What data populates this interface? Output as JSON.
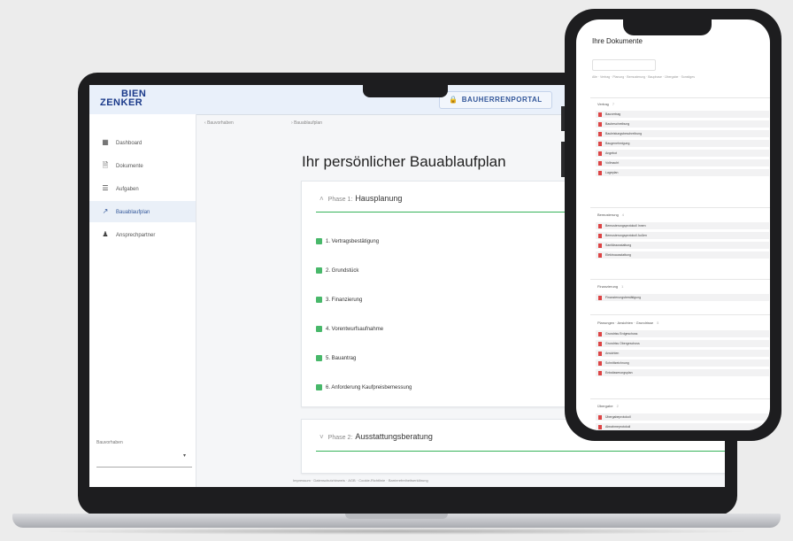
{
  "laptop": {
    "logo_line1": "BIEN",
    "logo_line2": "ZENKER",
    "portal_button": "BAUHERRENPORTAL",
    "sidebar": {
      "items": [
        {
          "label": "Dashboard",
          "icon": "dashboard-icon"
        },
        {
          "label": "Dokumente",
          "icon": "document-icon"
        },
        {
          "label": "Aufgaben",
          "icon": "tasks-icon"
        },
        {
          "label": "Bauablaufplan",
          "icon": "chart-line-icon"
        },
        {
          "label": "Ansprechpartner",
          "icon": "people-icon"
        }
      ],
      "active_index": 3,
      "select_label": "Bauvorhaben"
    },
    "breadcrumb": [
      "Bauvorhaben",
      "Bauablaufplan"
    ],
    "title": "Ihr persönlicher Bauablaufplan",
    "phases": [
      {
        "number": "Phase 1:",
        "name": "Hausplanung",
        "steps": [
          "1. Vertragsbestätigung",
          "2. Grundstück",
          "3. Finanzierung",
          "4. Vorentwurfsaufnahme",
          "5. Bauantrag",
          "6. Anforderung Kaufpreisbemessung"
        ]
      },
      {
        "number": "Phase 2:",
        "name": "Ausstattungsberatung",
        "steps": []
      }
    ],
    "footer_links": "Impressum · Datenschutzhinweis · AGB · Cookie-Richtlinie · Barrierefreiheitserklärung"
  },
  "phone": {
    "title": "Ihre Dokumente",
    "filter_text": "Alle · Vertrag · Planung · Bemusterung · Bauphase · Übergabe · Sonstiges",
    "sections": [
      {
        "name": "Vertrag",
        "count": "7",
        "items": [
          "Bauvertrag",
          "Baubeschreibung",
          "Bauleistungsbeschreibung",
          "Baugenehmigung",
          "Angebot",
          "Vollmacht",
          "Lageplan"
        ]
      },
      {
        "name": "Bemusterung",
        "count": "4",
        "items": [
          "Bemusterungsprotokoll Innen",
          "Bemusterungsprotokoll Außen",
          "Sanitärausstattung",
          "Elektroausstattung"
        ]
      },
      {
        "name": "Finanzierung",
        "count": "1",
        "items": [
          "Finanzierungsbestätigung"
        ]
      },
      {
        "name": "Planungen · Ansichten · Grundrisse",
        "count": "5",
        "items": [
          "Grundriss Erdgeschoss",
          "Grundriss Obergeschoss",
          "Ansichten",
          "Schnittzeichnung",
          "Entwässerungsplan"
        ]
      },
      {
        "name": "Übergabe",
        "count": "2",
        "items": [
          "Übergabeprotokoll",
          "Abnahmeprotokoll"
        ]
      }
    ]
  }
}
